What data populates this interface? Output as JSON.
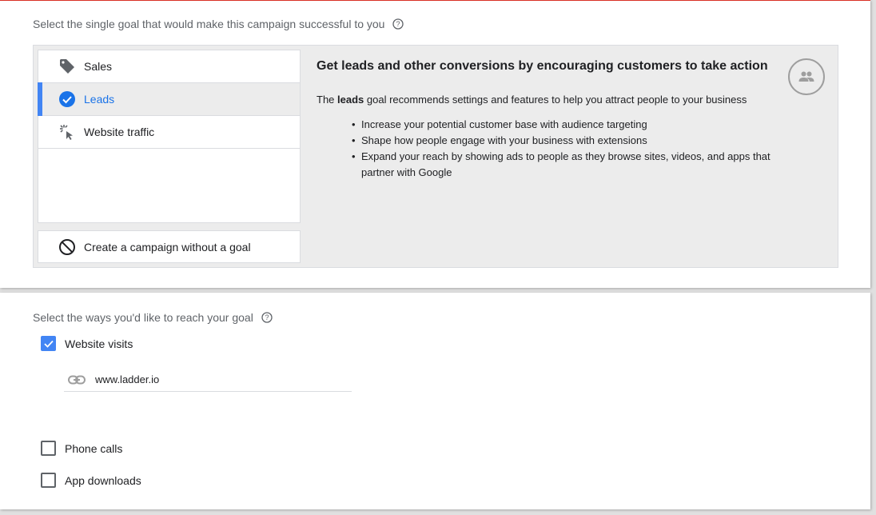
{
  "goal_section": {
    "label": "Select the single goal that would make this campaign successful to you",
    "goals": [
      {
        "label": "Sales",
        "icon": "tag-icon",
        "selected": false
      },
      {
        "label": "Leads",
        "icon": "check-circle-icon",
        "selected": true
      },
      {
        "label": "Website traffic",
        "icon": "cursor-click-icon",
        "selected": false
      }
    ],
    "no_goal_label": "Create a campaign without a goal",
    "detail": {
      "title": "Get leads and other conversions by encouraging customers to take action",
      "desc_prefix": "The ",
      "desc_bold": "leads",
      "desc_suffix": " goal recommends settings and features to help you attract people to your business",
      "bullets": [
        "Increase your potential customer base with audience targeting",
        "Shape how people engage with your business with extensions",
        "Expand your reach by showing ads to people as they browse sites, videos, and apps that partner with Google"
      ],
      "icon": "audience-icon"
    }
  },
  "reach_section": {
    "label": "Select the ways you'd like to reach your goal",
    "options": [
      {
        "label": "Website visits",
        "checked": true
      },
      {
        "label": "Phone calls",
        "checked": false
      },
      {
        "label": "App downloads",
        "checked": false
      }
    ],
    "website_url": "www.ladder.io"
  },
  "colors": {
    "accent": "#4285f4",
    "selected_text": "#1a73e8",
    "top_border": "#d93025"
  }
}
